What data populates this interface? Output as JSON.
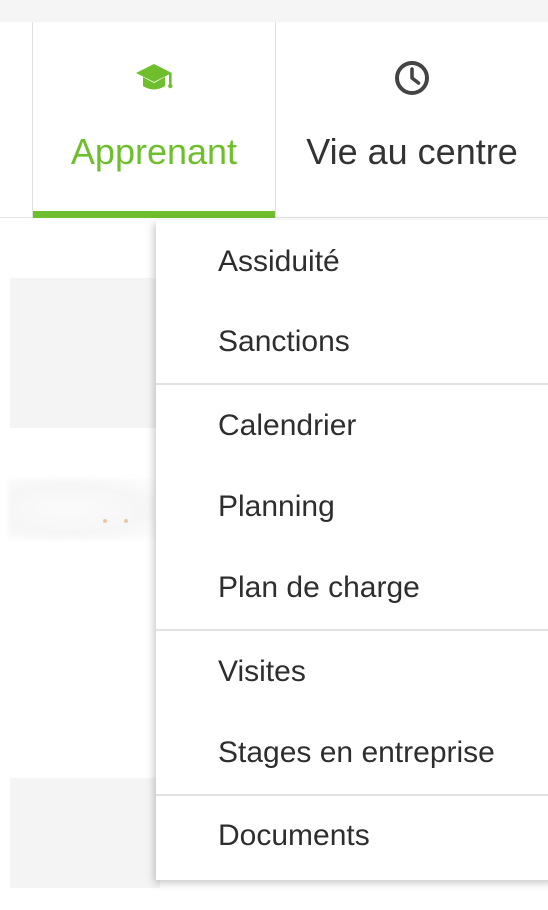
{
  "nav": {
    "tabs": [
      {
        "label": "Apprenant",
        "icon": "graduation-cap-icon",
        "active": true
      },
      {
        "label": "Vie au centre",
        "icon": "clock-icon",
        "active": false
      }
    ],
    "accent_color": "#6fbe2e"
  },
  "dropdown": {
    "groups": [
      {
        "items": [
          "Assiduité",
          "Sanctions"
        ]
      },
      {
        "items": [
          "Calendrier",
          "Planning",
          "Plan de charge"
        ]
      },
      {
        "items": [
          "Visites",
          "Stages en entreprise"
        ]
      },
      {
        "items": [
          "Documents"
        ]
      }
    ]
  }
}
